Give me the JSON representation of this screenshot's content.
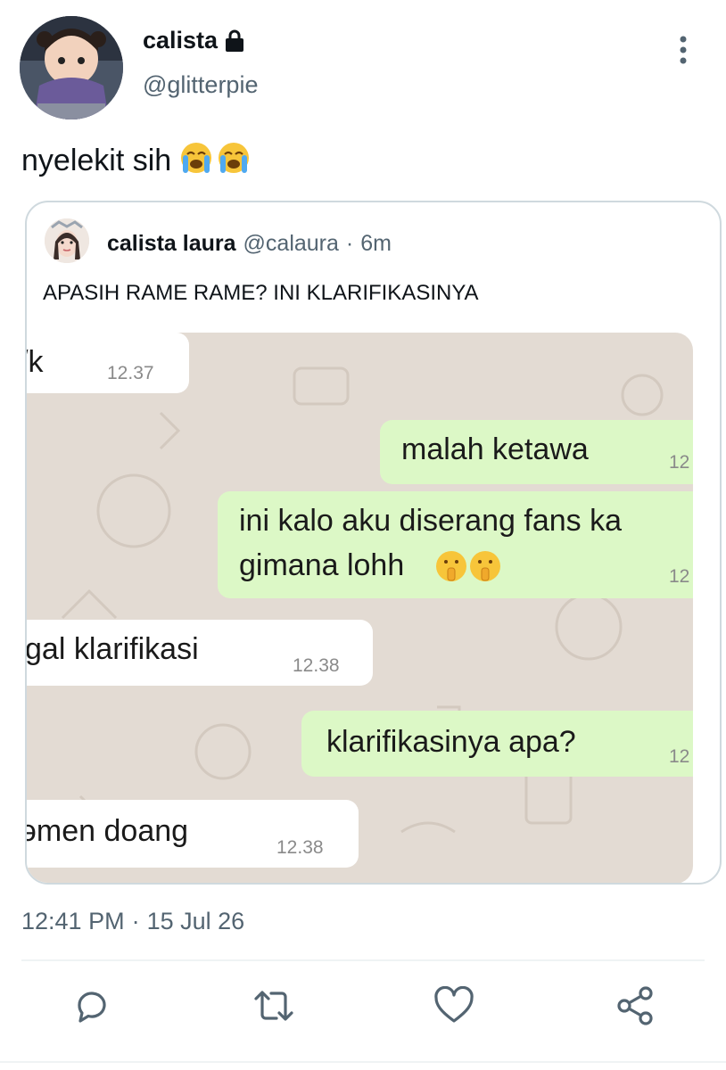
{
  "tweet": {
    "author": {
      "display_name": "calista",
      "handle": "@glitterpie",
      "protected": true
    },
    "text": "nyelekit sih",
    "emojis": [
      "loudly-crying-face",
      "loudly-crying-face"
    ],
    "time": "12:41 PM",
    "date": "15 Jul 26",
    "date_separator": "·"
  },
  "quote": {
    "display_name": "calista laura",
    "handle": "@calaura",
    "separator": "·",
    "age": "6m",
    "text": "APASIH RAME RAME? INI KLARIFIKASINYA"
  },
  "chat_screenshot": {
    "messages": [
      {
        "side": "incoming",
        "text": "/k",
        "time": "12.37"
      },
      {
        "side": "outgoing",
        "text": "malah ketawa",
        "time": "12"
      },
      {
        "side": "outgoing",
        "text_line1": "ini kalo aku diserang fans ka",
        "text_line2": "gimana lohh",
        "time": "12"
      },
      {
        "side": "incoming",
        "text": "gal klarifikasi",
        "time": "12.38"
      },
      {
        "side": "outgoing",
        "text": "klarifikasinya apa?",
        "time": "12"
      },
      {
        "side": "incoming",
        "text": "əmen doang",
        "time": "12.38"
      }
    ]
  },
  "actions": [
    {
      "name": "reply",
      "icon": "reply-icon"
    },
    {
      "name": "retweet",
      "icon": "retweet-icon"
    },
    {
      "name": "like",
      "icon": "heart-icon"
    },
    {
      "name": "share",
      "icon": "share-icon"
    }
  ],
  "colors": {
    "text_primary": "#0f1419",
    "text_secondary": "#536471",
    "border": "#cfd9de",
    "chat_bg": "#e3dbd3",
    "bubble_out": "#dcf8c6",
    "bubble_in": "#ffffff"
  }
}
